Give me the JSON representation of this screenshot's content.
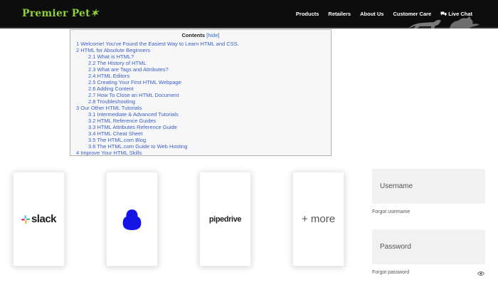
{
  "header": {
    "brand": "Premier Pet",
    "brand_accent": "✶",
    "nav": [
      "Products",
      "Retailers",
      "About Us",
      "Customer Care"
    ],
    "chat_label": "Live Chat",
    "colors": {
      "background": "#0d0d0d",
      "brand": "#8fcf3c",
      "text": "#ffffff"
    }
  },
  "toc": {
    "title": "Contents",
    "hide_label": "[hide]",
    "items": [
      "1 Welcome! You've Found the Easiest Way to Learn HTML and CSS.",
      "2 HTML for Absolute Beginners",
      "2.1 What is HTML?",
      "2.2 The History of HTML",
      "2.3 What are Tags and Attributes?",
      "2.4 HTML Editors",
      "2.5 Creating Your First HTML Webpage",
      "2.6 Adding Content",
      "2.7 How To Close an HTML Document",
      "2.8 Troubleshooting",
      "3 Our Other HTML Tutorials",
      "3.1 Intermediate & Advanced Tutorials",
      "3.2 HTML Reference Guides",
      "3.3 HTML Attributes Reference Guide",
      "3.4 HTML Cheat Sheet",
      "3.5 The HTML.com Blog",
      "3.6 The HTML.com Guide to Web Hosting",
      "4 Improve Your HTML Skills"
    ],
    "link_color": "#3a5fc8"
  },
  "integrations": {
    "slack": "slack",
    "pipedrive": "pipedrive",
    "more": "+ more"
  },
  "login": {
    "username_placeholder": "Username",
    "forgot_username": "Forgot username",
    "password_placeholder": "Password",
    "forgot_password": "Forgot password"
  }
}
